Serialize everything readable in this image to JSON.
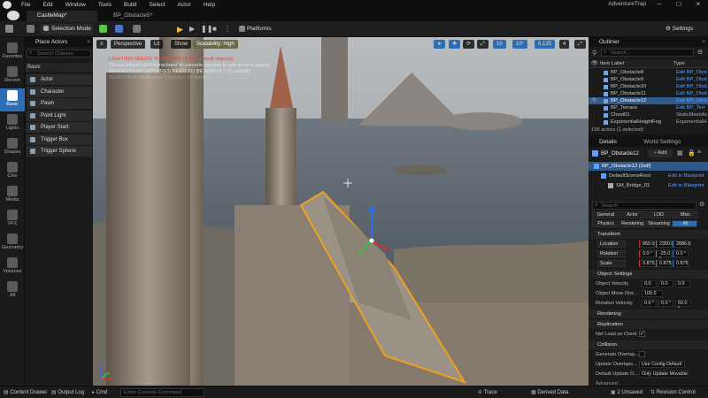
{
  "menubar": {
    "items": [
      "File",
      "Edit",
      "Window",
      "Tools",
      "Build",
      "Select",
      "Actor",
      "Help"
    ],
    "app_title": "AdventureTrap"
  },
  "tabs": [
    "CastleMap*",
    "BP_Obstacle5*"
  ],
  "toolbar": {
    "selection_mode": "Selection Mode",
    "platforms": "Platforms",
    "settings": "Settings"
  },
  "left_rail": [
    {
      "label": "Favorites",
      "icon": "star-icon"
    },
    {
      "label": "Recent",
      "icon": "clock-icon"
    },
    {
      "label": "Basic",
      "icon": "cubes-icon"
    },
    {
      "label": "Lights",
      "icon": "bulb-icon"
    },
    {
      "label": "Shapes",
      "icon": "shapes-icon"
    },
    {
      "label": "Cine",
      "icon": "camera-icon"
    },
    {
      "label": "Media",
      "icon": "film-icon"
    },
    {
      "label": "VFX",
      "icon": "sparkle-icon"
    },
    {
      "label": "Geometry",
      "icon": "geometry-icon"
    },
    {
      "label": "Volumes",
      "icon": "volume-icon"
    },
    {
      "label": "All",
      "icon": "grid-icon"
    }
  ],
  "place_actors": {
    "title": "Place Actors",
    "search_placeholder": "Search Classes",
    "category": "Basic",
    "items": [
      "Actor",
      "Character",
      "Pawn",
      "Point Light",
      "Player Start",
      "Trigger Box",
      "Trigger Sphere"
    ]
  },
  "viewport": {
    "perspective": "Perspective",
    "lit": "Lit",
    "show": "Show",
    "scalability": "Scalability: High",
    "grid": "10",
    "angle": "10°",
    "scale": "0.125",
    "camera_speed": "4",
    "messages": [
      {
        "text": "LIGHTING NEEDS TO BE REBUILT (1 unbuilt objects)",
        "color": "#ff3a3a"
      },
      {
        "text": "'DumpUnbuiltLightInteractions' in console window to see what is unbuilt",
        "color": "#e0e0e0"
      },
      {
        "text": "REFLECTION CAPTURES NEED TO BE REBUILT (1 unbuilt)",
        "color": "#e0e0e0"
      },
      {
        "text": "'Build > Build Reflection Captures' to update",
        "color": "#e0e0e0"
      }
    ]
  },
  "outliner": {
    "title": "Outliner",
    "search_placeholder": "Search...",
    "col_label": "Item Label",
    "col_type": "Type",
    "rows": [
      {
        "label": "BP_Obstacle8",
        "type": "Edit BP_Obst"
      },
      {
        "label": "BP_Obstacle9",
        "type": "Edit BP_Obst"
      },
      {
        "label": "BP_Obstacle10",
        "type": "Edit BP_Obst"
      },
      {
        "label": "BP_Obstacle11",
        "type": "Edit BP_Obst"
      },
      {
        "label": "BP_Obstacle12",
        "type": "Edit BP_Obst"
      },
      {
        "label": "BP_Terrace",
        "type": "Edit BP_Terr"
      },
      {
        "label": "Chest01",
        "type": "StaticMeshAc"
      },
      {
        "label": "ExponentialHeightFog",
        "type": "ExponentialH"
      }
    ],
    "count": "156 actors (1 selected)"
  },
  "details": {
    "tab": "Details",
    "tab2": "World Settings",
    "actor_name": "BP_Obstacle12",
    "add": "Add",
    "components": [
      {
        "label": "BP_Obstacle12 (Self)",
        "link": ""
      },
      {
        "label": "DefaultSceneRoot",
        "link": "Edit in Blueprint"
      },
      {
        "label": "SM_Bridge_01",
        "link": "Edit in Blueprint"
      }
    ],
    "search_placeholder": "Search",
    "filters1": [
      "General",
      "Actor",
      "LOD",
      "Misc"
    ],
    "filters2": [
      "Physics",
      "Rendering",
      "Streaming",
      "All"
    ],
    "transform": {
      "title": "Transform",
      "location_label": "Location",
      "location": [
        "850.0",
        "2350.0",
        "2886.0"
      ],
      "rotation_label": "Rotation",
      "rotation": [
        "0.0 °",
        "-25.0 °",
        "0.0 °"
      ],
      "scale_label": "Scale",
      "scale": [
        "0.875",
        "0.875",
        "0.875"
      ]
    },
    "object_settings": {
      "title": "Object Settings",
      "object_velocity": "Object Velocity",
      "velocity": [
        "0.0",
        "0.0",
        "0.0"
      ],
      "object_move_dist": "Object Move Dist...",
      "move_dist": "100.0",
      "rotation_velocity": "Rotation Velocity",
      "rot_vel": [
        "0.0 °",
        "0.0 °",
        "50.0 °"
      ]
    },
    "rendering": "Rendering",
    "replication": "Replication",
    "net_load": "Net Load on Client",
    "collision": "Collision",
    "gen_overlap": "Generate Overlap...",
    "update_overlap": "Update Overlaps...",
    "update_overlap_val": "Use Config Default",
    "default_update": "Default Update O...",
    "default_update_val": "Only Update Movable",
    "advanced": "Advanced"
  },
  "statusbar": {
    "content_drawer": "Content Drawer",
    "output_log": "Output Log",
    "cmd": "Cmd",
    "console_placeholder": "Enter Console Command",
    "trace": "Trace",
    "derived": "Derived Data",
    "unsaved": "2 Unsaved",
    "revision": "Revision Control"
  },
  "colors": {
    "accent_blue": "#2d6db5",
    "selection": "#2f5a8c",
    "link": "#5aa0ff",
    "play_green": "#5cc24a",
    "gizmo_orange": "#f0a020"
  }
}
